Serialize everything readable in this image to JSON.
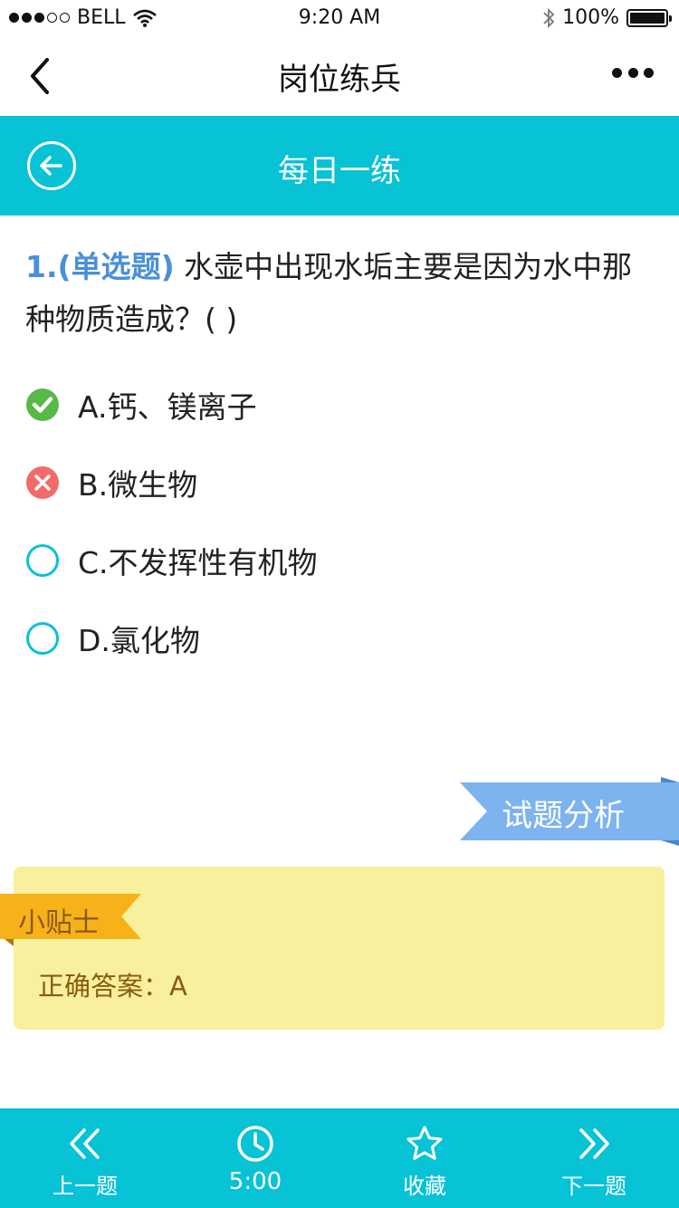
{
  "status_bar": {
    "carrier": "BELL",
    "time": "9:20 AM",
    "battery": "100%"
  },
  "nav": {
    "title": "岗位练兵"
  },
  "header": {
    "title": "每日一练"
  },
  "question": {
    "number_type": "1.(单选题)",
    "text": "水壶中出现水垢主要是因为水中那种物质造成？( )"
  },
  "options": [
    {
      "label": "A.钙、镁离子",
      "state": "correct"
    },
    {
      "label": "B.微生物",
      "state": "wrong"
    },
    {
      "label": "C.不发挥性有机物",
      "state": "unselected"
    },
    {
      "label": "D.氯化物",
      "state": "unselected"
    }
  ],
  "analysis": {
    "label": "试题分析"
  },
  "tips": {
    "tag": "小贴士",
    "answer": "正确答案：A"
  },
  "toolbar": {
    "prev": "上一题",
    "timer": "5:00",
    "favorite": "收藏",
    "next": "下一题"
  },
  "colors": {
    "teal": "#08c2d6",
    "question_blue": "#4a90d6",
    "correct_green": "#57b947",
    "wrong_red": "#f26b6b",
    "ribbon_blue": "#7db3ee",
    "tips_yellow": "#f8f09c",
    "tag_orange": "#f7b21a"
  }
}
